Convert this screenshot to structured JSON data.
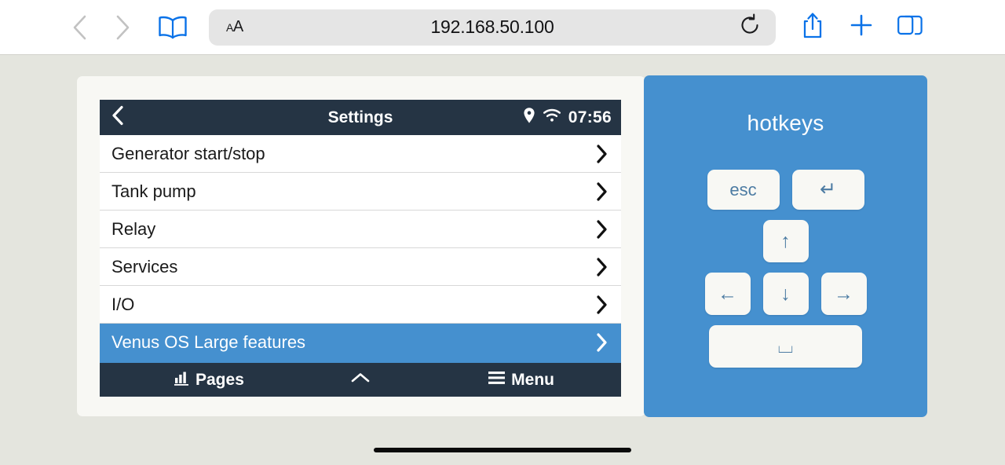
{
  "browser": {
    "back_icon": "chevron-left-icon",
    "forward_icon": "chevron-right-icon",
    "bookmarks_icon": "book-icon",
    "text_size_small": "A",
    "text_size_large": "A",
    "url": "192.168.50.100",
    "reload_icon": "reload-icon",
    "share_icon": "share-icon",
    "newtab_icon": "plus-icon",
    "tabs_icon": "tabs-icon"
  },
  "gx": {
    "header": {
      "back_icon": "chevron-left-icon",
      "title": "Settings",
      "location_icon": "location-pin-icon",
      "wifi_icon": "wifi-icon",
      "clock": "07:56"
    },
    "rows": [
      {
        "label": "Generator start/stop",
        "selected": false
      },
      {
        "label": "Tank pump",
        "selected": false
      },
      {
        "label": "Relay",
        "selected": false
      },
      {
        "label": "Services",
        "selected": false
      },
      {
        "label": "I/O",
        "selected": false
      },
      {
        "label": "Venus OS Large features",
        "selected": true
      }
    ],
    "footer": {
      "pages_label": "Pages",
      "pages_icon": "bar-chart-icon",
      "collapse_icon": "chevron-up-icon",
      "menu_label": "Menu",
      "menu_icon": "hamburger-icon"
    }
  },
  "hotkeys": {
    "title": "hotkeys",
    "keys": {
      "esc": "esc",
      "enter": "↵",
      "up": "↑",
      "left": "←",
      "down": "↓",
      "right": "→",
      "space": "⌴"
    }
  },
  "colors": {
    "accent_blue": "#4590cf",
    "dark_navy": "#253444",
    "page_background": "#e4e5de",
    "card_background": "#f8f8f4",
    "browser_blue": "#0a72e8"
  }
}
